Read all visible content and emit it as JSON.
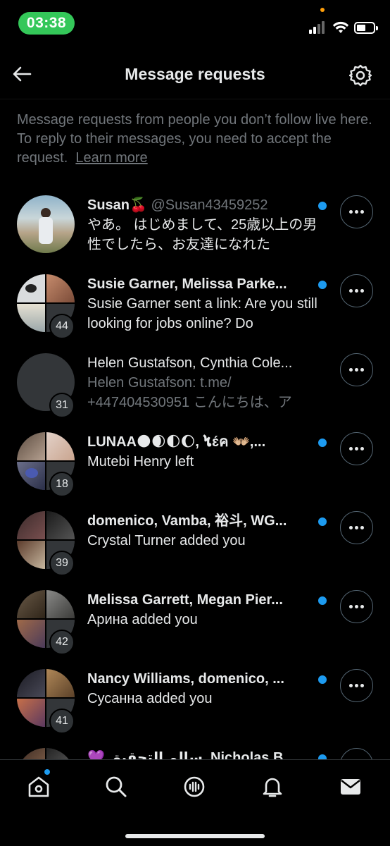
{
  "status_bar": {
    "time": "03:38"
  },
  "header": {
    "title": "Message requests"
  },
  "info": {
    "text": "Message requests from people you don’t follow live here. To reply to their messages, you need to accept the request.",
    "link": "Learn more"
  },
  "conversations": [
    {
      "title": "Susan🍒",
      "handle": "@Susan43459252",
      "message": "やあ。 はじめまして、25歳以上の男性でしたら、お友達になれた",
      "unread": true,
      "count": ""
    },
    {
      "title": "Susie Garner, Melissa Parke...",
      "handle": "",
      "message": "Susie Garner sent a link: Are you still looking for jobs online?  Do",
      "unread": true,
      "count": "44"
    },
    {
      "title": "Helen Gustafson, Cynthia Cole...",
      "handle": "",
      "message": "Helen Gustafson: t.me/ +447404530951 こんにちは、ア",
      "unread": false,
      "count": "31"
    },
    {
      "title": "LUNAA🌑🌒🌓🌔, ໄɛ́ค 👐🏼,...",
      "handle": "",
      "message": "Mutebi Henry left",
      "unread": true,
      "count": "18"
    },
    {
      "title": "domenico, Vamba, 裕斗, WG...",
      "handle": "",
      "message": "Crystal Turner added you",
      "unread": true,
      "count": "39"
    },
    {
      "title": "Melissa Garrett, Megan Pier...",
      "handle": "",
      "message": "Арина added you",
      "unread": true,
      "count": "42"
    },
    {
      "title": "Nancy Williams, domenico, ...",
      "handle": "",
      "message": "Сусанна added you",
      "unread": true,
      "count": "41"
    },
    {
      "title": "💜 سالم التحقيق, Nicholas B...",
      "handle": "",
      "message": "",
      "unread": true,
      "count": ""
    }
  ],
  "colors": {
    "accent": "#1d9bf0",
    "background": "#000000",
    "muted": "#71767b",
    "time_pill": "#34c759"
  },
  "bottom_nav": [
    "home-icon",
    "search-icon",
    "spaces-icon",
    "notifications-icon",
    "messages-icon"
  ]
}
